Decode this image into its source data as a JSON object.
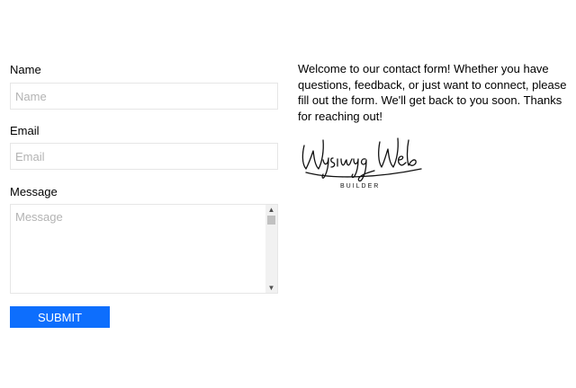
{
  "form": {
    "name_label": "Name",
    "name_placeholder": "Name",
    "email_label": "Email",
    "email_placeholder": "Email",
    "message_label": "Message",
    "message_placeholder": "Message",
    "submit_label": "SUBMIT"
  },
  "intro": {
    "text": "Welcome to our contact form! Whether you have questions, feedback, or just want to connect, please fill out the form. We'll get back to you soon. Thanks for reaching out!"
  },
  "logo": {
    "script_text": "Wysiwyg Web",
    "sub_text": "BUILDER"
  },
  "colors": {
    "accent": "#0d6efd",
    "border": "#e6e6e6",
    "placeholder": "#b3b3b3"
  },
  "icons": {
    "scroll_up": "triangle-up",
    "scroll_down": "triangle-down"
  }
}
